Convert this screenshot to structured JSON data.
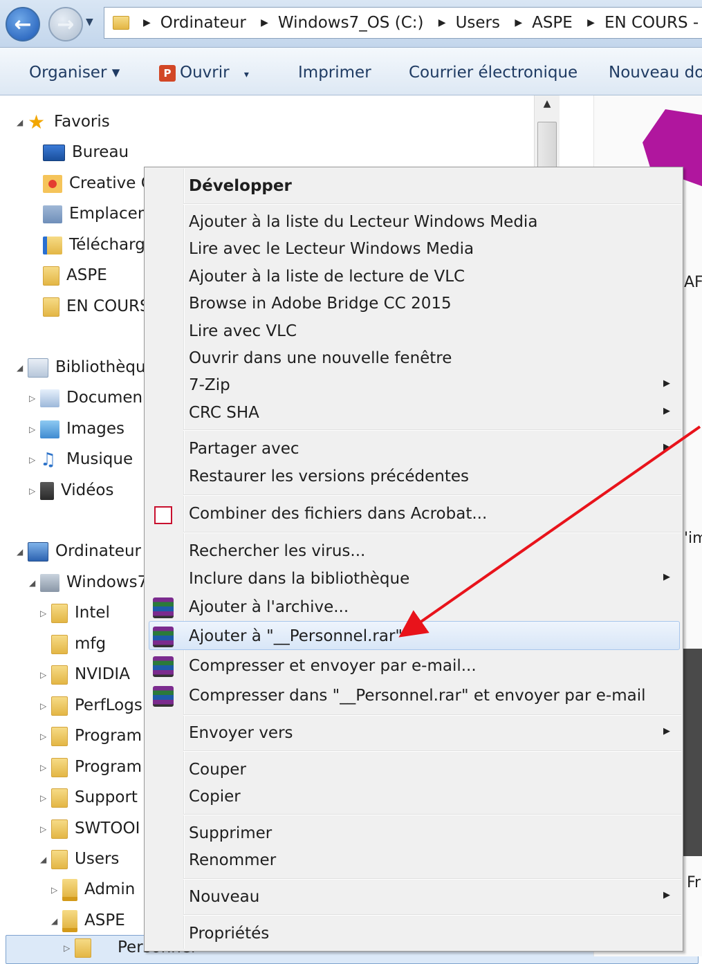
{
  "breadcrumbs": [
    "Ordinateur",
    "Windows7_OS (C:)",
    "Users",
    "ASPE",
    "EN COURS - RAP"
  ],
  "toolbar": {
    "organize": "Organiser ▾",
    "open": "Ouvrir",
    "open_dd": "▾",
    "print": "Imprimer",
    "email": "Courrier électronique",
    "new_doc": "Nouveau do"
  },
  "nav": {
    "favorites": "Favoris",
    "desktop": "Bureau",
    "creative": "Creative C",
    "locations": "Emplacem",
    "downloads": "Télécharg",
    "aspe": "ASPE",
    "en_cours": "EN COURS",
    "libraries": "Bibliothèqu",
    "documents": "Documen",
    "images": "Images",
    "music": "Musique",
    "videos": "Vidéos",
    "computer": "Ordinateur",
    "windows": "Windows7",
    "intel": "Intel",
    "mfg": "mfg",
    "nvidia": "NVIDIA",
    "perflogs": "PerfLogs",
    "program1": "Program",
    "program2": "Program",
    "support": "Support",
    "swtools": "SWTOOI",
    "users": "Users",
    "admin": "Admin",
    "aspe2": "ASPE",
    "personnel": "Personnel"
  },
  "preview": {
    "t1": "AF",
    "t2": "'im",
    "t3": "Fr"
  },
  "menu": {
    "expand": "Développer",
    "wmp_add": "Ajouter à la liste du Lecteur Windows Media",
    "wmp_play": "Lire avec le Lecteur Windows Media",
    "vlc_add": "Ajouter à la liste de lecture de VLC",
    "bridge": "Browse in Adobe Bridge CC 2015",
    "vlc_play": "Lire avec VLC",
    "new_window": "Ouvrir dans une nouvelle fenêtre",
    "zip7": "7-Zip",
    "crc": "CRC SHA",
    "share": "Partager avec",
    "restore": "Restaurer les versions précédentes",
    "acrobat": "Combiner des fichiers dans Acrobat...",
    "virus": "Rechercher les virus...",
    "include_lib": "Inclure dans la bibliothèque",
    "add_archive": "Ajouter à l'archive...",
    "add_rar": "Ajouter à \"__Personnel.rar\"",
    "compress_email": "Compresser et envoyer par e-mail...",
    "compress_rar_email": "Compresser dans \"__Personnel.rar\" et envoyer par e-mail",
    "send_to": "Envoyer vers",
    "cut": "Couper",
    "copy": "Copier",
    "delete": "Supprimer",
    "rename": "Renommer",
    "new": "Nouveau",
    "properties": "Propriétés"
  },
  "colors": {
    "highlight": "#d8e6f7",
    "annotation_arrow": "#e8131b"
  }
}
